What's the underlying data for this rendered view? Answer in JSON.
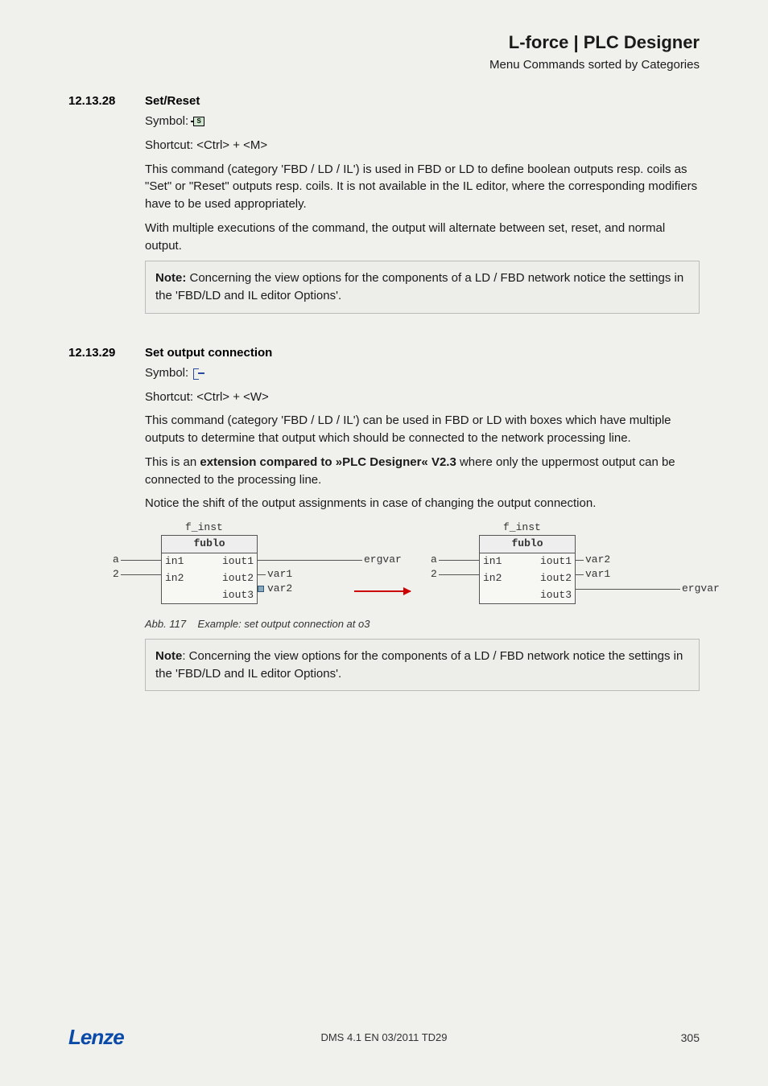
{
  "header": {
    "title": "L-force | PLC Designer",
    "subtitle": "Menu Commands sorted by Categories"
  },
  "sec1": {
    "number": "12.13.28",
    "title": "Set/Reset",
    "symbol_label": "Symbol:",
    "shortcut": "Shortcut:  <Ctrl> + <M>",
    "p1": "This command (category 'FBD / LD / IL') is used in FBD or LD to define boolean outputs resp. coils as \"Set\" or \"Reset\" outputs resp. coils. It is not available in the IL editor, where the corresponding modifiers have to be used appropriately.",
    "p2": "With multiple executions of the command, the output will alternate between set, reset, and normal output.",
    "note_label": "Note:",
    "note_text": " Concerning the view options for the components of a LD / FBD network notice the settings in the 'FBD/LD and IL editor Options'."
  },
  "sec2": {
    "number": "12.13.29",
    "title": "Set output connection",
    "symbol_label": "Symbol:",
    "shortcut": "Shortcut:  <Ctrl> + <W>",
    "p1": "This command (category 'FBD / LD / IL') can be used in FBD or LD with boxes which have multiple outputs to determine that output which should be connected to the network processing line.",
    "p2a": "This is an ",
    "p2b": "extension compared to »PLC Designer« V2.3",
    "p2c": " where only the uppermost output can be connected to the processing line.",
    "p3": "Notice the shift of the output assignments in case of changing the output connection.",
    "caption_label": "Abb. 117",
    "caption_text": "Example: set output connection at o3",
    "note_label": "Note",
    "note_text": ": Concerning the view options for the components of a LD / FBD network notice the settings in the 'FBD/LD and IL editor Options'."
  },
  "diagram": {
    "inst": "f_inst",
    "block": "fublo",
    "in1": "in1",
    "in2": "in2",
    "iout1": "iout1",
    "iout2": "iout2",
    "iout3": "iout3",
    "a": "a",
    "two": "2",
    "var1": "var1",
    "var2": "var2",
    "ergvar": "ergvar"
  },
  "footer": {
    "logo": "Lenze",
    "center": "DMS 4.1 EN 03/2011 TD29",
    "page": "305"
  }
}
